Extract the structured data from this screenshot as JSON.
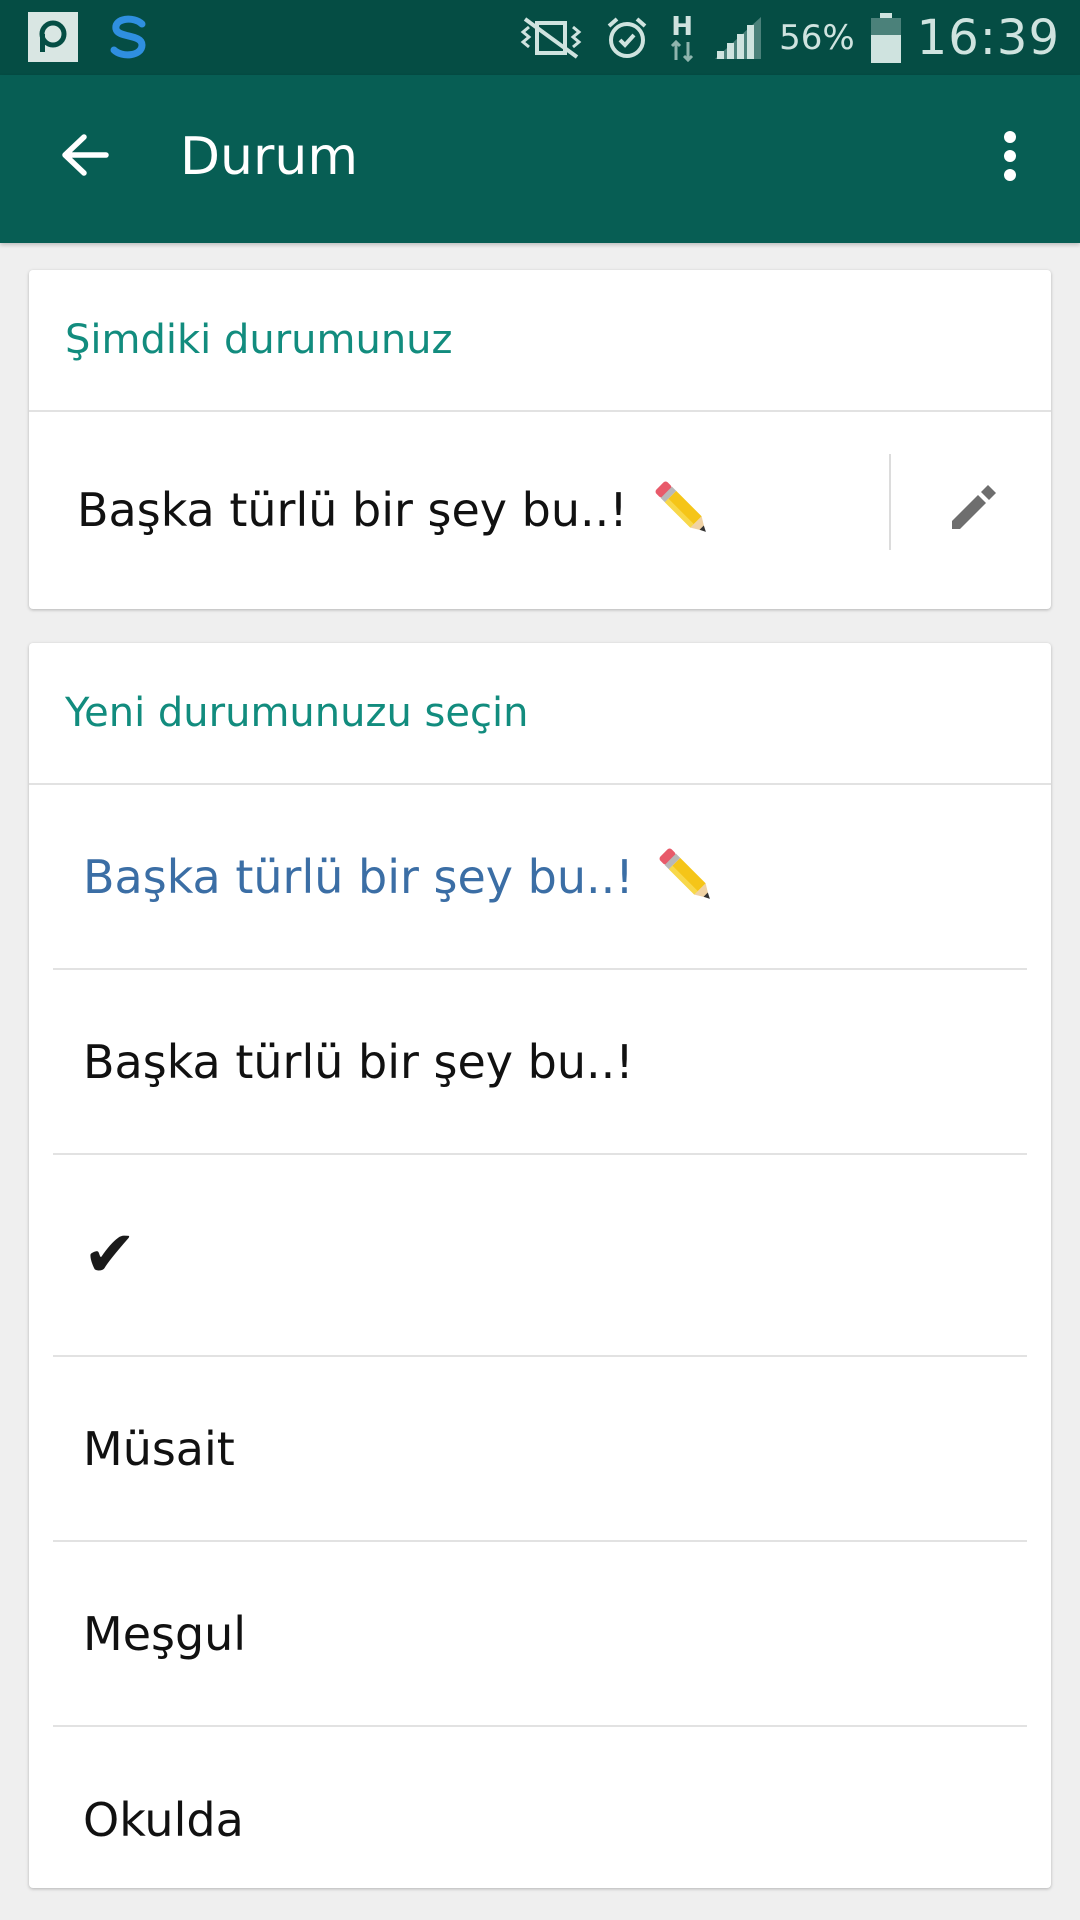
{
  "status_bar": {
    "battery_percent": "56%",
    "time": "16:39",
    "network_type": "H",
    "icons": [
      "p-app-icon",
      "s-app-icon",
      "vibrate-mute-icon",
      "alarm-icon",
      "data-transfer-icon",
      "signal-icon",
      "battery-icon"
    ]
  },
  "app_bar": {
    "title": "Durum",
    "back_icon": "arrow-left-icon",
    "menu_icon": "more-vert-icon"
  },
  "current_status": {
    "header": "Şimdiki durumunuz",
    "text": "Başka türlü bir şey bu..!",
    "emoji": "pencil-emoji",
    "edit_icon": "edit-pencil-icon"
  },
  "choose_status": {
    "header": "Yeni durumunuzu seçin",
    "items": [
      {
        "label": "Başka türlü bir şey bu..!",
        "emoji": "pencil-emoji",
        "selected": true
      },
      {
        "label": "Başka türlü bir şey bu..!",
        "selected": false
      },
      {
        "label": "✔",
        "selected": false
      },
      {
        "label": "Müsait",
        "selected": false
      },
      {
        "label": "Meşgul",
        "selected": false
      },
      {
        "label": "Okulda",
        "selected": false
      }
    ]
  },
  "colors": {
    "status_bar": "#054d44",
    "app_bar": "#075e54",
    "accent": "#128c7e",
    "selected_text": "#3b6ea5",
    "background": "#efefef"
  }
}
